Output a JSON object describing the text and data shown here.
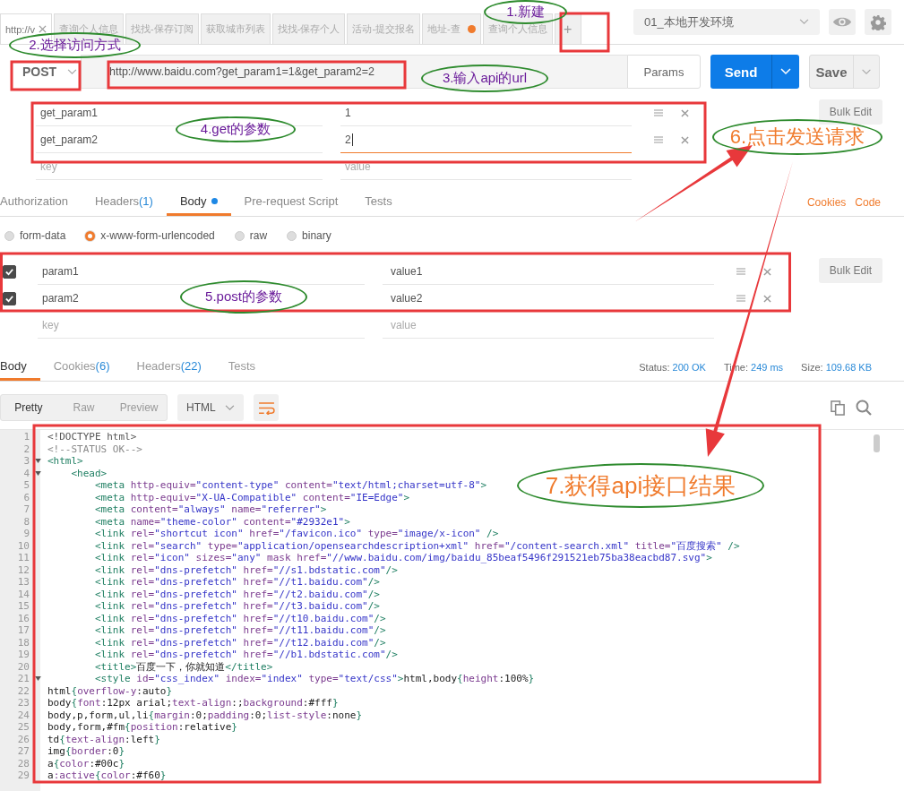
{
  "tabs": [
    {
      "label": "http://v",
      "selected": true,
      "unsaved": false
    },
    {
      "label": "查询个人信息",
      "selected": false,
      "unsaved": false
    },
    {
      "label": "找找-保存订阅",
      "selected": false,
      "unsaved": false
    },
    {
      "label": "获取城市列表",
      "selected": false,
      "unsaved": false
    },
    {
      "label": "找找-保存个人",
      "selected": false,
      "unsaved": false
    },
    {
      "label": "活动-提交报名",
      "selected": false,
      "unsaved": false
    },
    {
      "label": "地址-查",
      "selected": false,
      "unsaved": true
    },
    {
      "label": "查询个人信息",
      "selected": false,
      "unsaved": false
    }
  ],
  "new_tab": "+",
  "environment": {
    "value": "01_本地开发环境"
  },
  "request": {
    "method": "POST",
    "url": "http://www.baidu.com?get_param1=1&get_param2=2",
    "params_button": "Params",
    "send": "Send",
    "save": "Save"
  },
  "query_params": {
    "rows": [
      {
        "key": "get_param1",
        "value": "1",
        "focused": false
      },
      {
        "key": "get_param2",
        "value": "2",
        "focused": true
      }
    ],
    "key_placeholder": "key",
    "value_placeholder": "value",
    "bulk_edit": "Bulk Edit"
  },
  "request_tabs": [
    {
      "label": "Authorization",
      "selected": false,
      "modified": false
    },
    {
      "label": "Headers",
      "count": "(1)",
      "selected": false,
      "modified": false
    },
    {
      "label": "Body",
      "selected": true,
      "modified": true
    },
    {
      "label": "Pre-request Script",
      "selected": false,
      "modified": false
    },
    {
      "label": "Tests",
      "selected": false,
      "modified": false
    }
  ],
  "request_links": [
    "Cookies",
    "Code"
  ],
  "body_modes": [
    {
      "label": "form-data",
      "selected": false
    },
    {
      "label": "x-www-form-urlencoded",
      "selected": true
    },
    {
      "label": "raw",
      "selected": false
    },
    {
      "label": "binary",
      "selected": false
    }
  ],
  "body_params": {
    "rows": [
      {
        "key": "param1",
        "value": "value1",
        "checked": true
      },
      {
        "key": "param2",
        "value": "value2",
        "checked": true
      }
    ],
    "key_placeholder": "key",
    "value_placeholder": "value",
    "bulk_edit": "Bulk Edit"
  },
  "response_tabs": [
    {
      "label": "Body",
      "selected": true
    },
    {
      "label": "Cookies",
      "count": "(6)",
      "selected": false
    },
    {
      "label": "Headers",
      "count": "(22)",
      "selected": false
    },
    {
      "label": "Tests",
      "selected": false
    }
  ],
  "response_meta": [
    {
      "label": "Status:",
      "value": "200 OK"
    },
    {
      "label": "Time:",
      "value": "249 ms"
    },
    {
      "label": "Size:",
      "value": "109.68 KB"
    }
  ],
  "view_modes": [
    {
      "label": "Pretty",
      "selected": true
    },
    {
      "label": "Raw",
      "selected": false
    },
    {
      "label": "Preview",
      "selected": false
    }
  ],
  "format": "HTML",
  "code": [
    {
      "n": "1",
      "foldable": false,
      "tokens": [
        {
          "kind": "doc",
          "text": "<!DOCTYPE html>"
        }
      ]
    },
    {
      "n": "2",
      "foldable": false,
      "tokens": [
        {
          "kind": "comment",
          "text": "<!--STATUS OK-->"
        }
      ]
    },
    {
      "n": "3",
      "foldable": true,
      "tokens": [
        {
          "kind": "tag",
          "text": "<html>"
        }
      ]
    },
    {
      "n": "4",
      "foldable": true,
      "tokens": [
        {
          "kind": "tag",
          "text": "    <head>"
        }
      ]
    },
    {
      "n": "5",
      "foldable": false,
      "tokens": [
        {
          "kind": "tag",
          "text": "        <meta "
        },
        {
          "kind": "attr",
          "text": "http-equiv="
        },
        {
          "kind": "str",
          "text": "\"content-type\""
        },
        {
          "kind": "attr",
          "text": " content="
        },
        {
          "kind": "str",
          "text": "\"text/html;charset=utf-8\""
        },
        {
          "kind": "tag",
          "text": ">"
        }
      ]
    },
    {
      "n": "6",
      "foldable": false,
      "tokens": [
        {
          "kind": "tag",
          "text": "        <meta "
        },
        {
          "kind": "attr",
          "text": "http-equiv="
        },
        {
          "kind": "str",
          "text": "\"X-UA-Compatible\""
        },
        {
          "kind": "attr",
          "text": " content="
        },
        {
          "kind": "str",
          "text": "\"IE=Edge\""
        },
        {
          "kind": "tag",
          "text": ">"
        }
      ]
    },
    {
      "n": "7",
      "foldable": false,
      "tokens": [
        {
          "kind": "tag",
          "text": "        <meta "
        },
        {
          "kind": "attr",
          "text": "content="
        },
        {
          "kind": "str",
          "text": "\"always\""
        },
        {
          "kind": "attr",
          "text": " name="
        },
        {
          "kind": "str",
          "text": "\"referrer\""
        },
        {
          "kind": "tag",
          "text": ">"
        }
      ]
    },
    {
      "n": "8",
      "foldable": false,
      "tokens": [
        {
          "kind": "tag",
          "text": "        <meta "
        },
        {
          "kind": "attr",
          "text": "name="
        },
        {
          "kind": "str",
          "text": "\"theme-color\""
        },
        {
          "kind": "attr",
          "text": " content="
        },
        {
          "kind": "str",
          "text": "\"#2932e1\""
        },
        {
          "kind": "tag",
          "text": ">"
        }
      ]
    },
    {
      "n": "9",
      "foldable": false,
      "tokens": [
        {
          "kind": "tag",
          "text": "        <link "
        },
        {
          "kind": "attr",
          "text": "rel="
        },
        {
          "kind": "str",
          "text": "\"shortcut icon\""
        },
        {
          "kind": "attr",
          "text": " href="
        },
        {
          "kind": "str",
          "text": "\"/favicon.ico\""
        },
        {
          "kind": "attr",
          "text": " type="
        },
        {
          "kind": "str",
          "text": "\"image/x-icon\""
        },
        {
          "kind": "tag",
          "text": " />"
        }
      ]
    },
    {
      "n": "10",
      "foldable": false,
      "tokens": [
        {
          "kind": "tag",
          "text": "        <link "
        },
        {
          "kind": "attr",
          "text": "rel="
        },
        {
          "kind": "str",
          "text": "\"search\""
        },
        {
          "kind": "attr",
          "text": " type="
        },
        {
          "kind": "str",
          "text": "\"application/opensearchdescription+xml\""
        },
        {
          "kind": "attr",
          "text": " href="
        },
        {
          "kind": "str",
          "text": "\"/content-search.xml\""
        },
        {
          "kind": "attr",
          "text": " title="
        },
        {
          "kind": "str",
          "text": "\"百度搜索\""
        },
        {
          "kind": "tag",
          "text": " />"
        }
      ]
    },
    {
      "n": "11",
      "foldable": false,
      "tokens": [
        {
          "kind": "tag",
          "text": "        <link "
        },
        {
          "kind": "attr",
          "text": "rel="
        },
        {
          "kind": "str",
          "text": "\"icon\""
        },
        {
          "kind": "attr",
          "text": " sizes="
        },
        {
          "kind": "str",
          "text": "\"any\""
        },
        {
          "kind": "attr",
          "text": " mask href="
        },
        {
          "kind": "str",
          "text": "\"//www.baidu.com/img/baidu_85beaf5496f291521eb75ba38eacbd87.svg\""
        },
        {
          "kind": "tag",
          "text": ">"
        }
      ]
    },
    {
      "n": "12",
      "foldable": false,
      "tokens": [
        {
          "kind": "tag",
          "text": "        <link "
        },
        {
          "kind": "attr",
          "text": "rel="
        },
        {
          "kind": "str",
          "text": "\"dns-prefetch\""
        },
        {
          "kind": "attr",
          "text": " href="
        },
        {
          "kind": "str",
          "text": "\"//s1.bdstatic.com\""
        },
        {
          "kind": "tag",
          "text": "/>"
        }
      ]
    },
    {
      "n": "13",
      "foldable": false,
      "tokens": [
        {
          "kind": "tag",
          "text": "        <link "
        },
        {
          "kind": "attr",
          "text": "rel="
        },
        {
          "kind": "str",
          "text": "\"dns-prefetch\""
        },
        {
          "kind": "attr",
          "text": " href="
        },
        {
          "kind": "str",
          "text": "\"//t1.baidu.com\""
        },
        {
          "kind": "tag",
          "text": "/>"
        }
      ]
    },
    {
      "n": "14",
      "foldable": false,
      "tokens": [
        {
          "kind": "tag",
          "text": "        <link "
        },
        {
          "kind": "attr",
          "text": "rel="
        },
        {
          "kind": "str",
          "text": "\"dns-prefetch\""
        },
        {
          "kind": "attr",
          "text": " href="
        },
        {
          "kind": "str",
          "text": "\"//t2.baidu.com\""
        },
        {
          "kind": "tag",
          "text": "/>"
        }
      ]
    },
    {
      "n": "15",
      "foldable": false,
      "tokens": [
        {
          "kind": "tag",
          "text": "        <link "
        },
        {
          "kind": "attr",
          "text": "rel="
        },
        {
          "kind": "str",
          "text": "\"dns-prefetch\""
        },
        {
          "kind": "attr",
          "text": " href="
        },
        {
          "kind": "str",
          "text": "\"//t3.baidu.com\""
        },
        {
          "kind": "tag",
          "text": "/>"
        }
      ]
    },
    {
      "n": "16",
      "foldable": false,
      "tokens": [
        {
          "kind": "tag",
          "text": "        <link "
        },
        {
          "kind": "attr",
          "text": "rel="
        },
        {
          "kind": "str",
          "text": "\"dns-prefetch\""
        },
        {
          "kind": "attr",
          "text": " href="
        },
        {
          "kind": "str",
          "text": "\"//t10.baidu.com\""
        },
        {
          "kind": "tag",
          "text": "/>"
        }
      ]
    },
    {
      "n": "17",
      "foldable": false,
      "tokens": [
        {
          "kind": "tag",
          "text": "        <link "
        },
        {
          "kind": "attr",
          "text": "rel="
        },
        {
          "kind": "str",
          "text": "\"dns-prefetch\""
        },
        {
          "kind": "attr",
          "text": " href="
        },
        {
          "kind": "str",
          "text": "\"//t11.baidu.com\""
        },
        {
          "kind": "tag",
          "text": "/>"
        }
      ]
    },
    {
      "n": "18",
      "foldable": false,
      "tokens": [
        {
          "kind": "tag",
          "text": "        <link "
        },
        {
          "kind": "attr",
          "text": "rel="
        },
        {
          "kind": "str",
          "text": "\"dns-prefetch\""
        },
        {
          "kind": "attr",
          "text": " href="
        },
        {
          "kind": "str",
          "text": "\"//t12.baidu.com\""
        },
        {
          "kind": "tag",
          "text": "/>"
        }
      ]
    },
    {
      "n": "19",
      "foldable": false,
      "tokens": [
        {
          "kind": "tag",
          "text": "        <link "
        },
        {
          "kind": "attr",
          "text": "rel="
        },
        {
          "kind": "str",
          "text": "\"dns-prefetch\""
        },
        {
          "kind": "attr",
          "text": " href="
        },
        {
          "kind": "str",
          "text": "\"//b1.bdstatic.com\""
        },
        {
          "kind": "tag",
          "text": "/>"
        }
      ]
    },
    {
      "n": "20",
      "foldable": false,
      "tokens": [
        {
          "kind": "tag",
          "text": "        <title>"
        },
        {
          "kind": "plain",
          "text": "百度一下，你就知道"
        },
        {
          "kind": "tag",
          "text": "</title>"
        }
      ]
    },
    {
      "n": "21",
      "foldable": true,
      "tokens": [
        {
          "kind": "tag",
          "text": "        <style "
        },
        {
          "kind": "attr",
          "text": "id="
        },
        {
          "kind": "str",
          "text": "\"css_index\""
        },
        {
          "kind": "attr",
          "text": " index="
        },
        {
          "kind": "str",
          "text": "\"index\""
        },
        {
          "kind": "attr",
          "text": " type="
        },
        {
          "kind": "str",
          "text": "\"text/css\""
        },
        {
          "kind": "tag",
          "text": ">"
        },
        {
          "kind": "plain",
          "text": "html,body"
        },
        {
          "kind": "tag",
          "text": "{"
        },
        {
          "kind": "prop",
          "text": "height"
        },
        {
          "kind": "plain",
          "text": ":100%"
        },
        {
          "kind": "tag",
          "text": "}"
        }
      ]
    },
    {
      "n": "22",
      "foldable": false,
      "tokens": [
        {
          "kind": "plain",
          "text": "html"
        },
        {
          "kind": "tag",
          "text": "{"
        },
        {
          "kind": "prop",
          "text": "overflow-y"
        },
        {
          "kind": "plain",
          "text": ":auto"
        },
        {
          "kind": "tag",
          "text": "}"
        }
      ]
    },
    {
      "n": "23",
      "foldable": false,
      "tokens": [
        {
          "kind": "plain",
          "text": "body"
        },
        {
          "kind": "tag",
          "text": "{"
        },
        {
          "kind": "prop",
          "text": "font"
        },
        {
          "kind": "plain",
          "text": ":12px arial;"
        },
        {
          "kind": "prop",
          "text": "text-align"
        },
        {
          "kind": "plain",
          "text": ":;"
        },
        {
          "kind": "prop",
          "text": "background"
        },
        {
          "kind": "plain",
          "text": ":#fff"
        },
        {
          "kind": "tag",
          "text": "}"
        }
      ]
    },
    {
      "n": "24",
      "foldable": false,
      "tokens": [
        {
          "kind": "plain",
          "text": "body,p,form,ul,li"
        },
        {
          "kind": "tag",
          "text": "{"
        },
        {
          "kind": "prop",
          "text": "margin"
        },
        {
          "kind": "plain",
          "text": ":0;"
        },
        {
          "kind": "prop",
          "text": "padding"
        },
        {
          "kind": "plain",
          "text": ":0;"
        },
        {
          "kind": "prop",
          "text": "list-style"
        },
        {
          "kind": "plain",
          "text": ":none"
        },
        {
          "kind": "tag",
          "text": "}"
        }
      ]
    },
    {
      "n": "25",
      "foldable": false,
      "tokens": [
        {
          "kind": "plain",
          "text": "body,form,#fm"
        },
        {
          "kind": "tag",
          "text": "{"
        },
        {
          "kind": "prop",
          "text": "position"
        },
        {
          "kind": "plain",
          "text": ":relative"
        },
        {
          "kind": "tag",
          "text": "}"
        }
      ]
    },
    {
      "n": "26",
      "foldable": false,
      "tokens": [
        {
          "kind": "plain",
          "text": "td"
        },
        {
          "kind": "tag",
          "text": "{"
        },
        {
          "kind": "prop",
          "text": "text-align"
        },
        {
          "kind": "plain",
          "text": ":left"
        },
        {
          "kind": "tag",
          "text": "}"
        }
      ]
    },
    {
      "n": "27",
      "foldable": false,
      "tokens": [
        {
          "kind": "plain",
          "text": "img"
        },
        {
          "kind": "tag",
          "text": "{"
        },
        {
          "kind": "prop",
          "text": "border"
        },
        {
          "kind": "plain",
          "text": ":0"
        },
        {
          "kind": "tag",
          "text": "}"
        }
      ]
    },
    {
      "n": "28",
      "foldable": false,
      "tokens": [
        {
          "kind": "plain",
          "text": "a"
        },
        {
          "kind": "tag",
          "text": "{"
        },
        {
          "kind": "prop",
          "text": "color"
        },
        {
          "kind": "plain",
          "text": ":#00c"
        },
        {
          "kind": "tag",
          "text": "}"
        }
      ]
    },
    {
      "n": "29",
      "foldable": false,
      "tokens": [
        {
          "kind": "plain",
          "text": "a"
        },
        {
          "kind": "prop",
          "text": ":active"
        },
        {
          "kind": "tag",
          "text": "{"
        },
        {
          "kind": "prop",
          "text": "color"
        },
        {
          "kind": "plain",
          "text": ":#f60"
        },
        {
          "kind": "tag",
          "text": "}"
        }
      ]
    }
  ],
  "annotations": [
    {
      "label": "1.新建",
      "kind": "note"
    },
    {
      "label": "2.选择访问方式",
      "kind": "note"
    },
    {
      "label": "3.输入api的url",
      "kind": "note"
    },
    {
      "label": "4.get的参数",
      "kind": "note"
    },
    {
      "label": "5.post的参数",
      "kind": "note"
    },
    {
      "label": "6.点击发送请求",
      "kind": "callout"
    },
    {
      "label": "7.获得api接口结果",
      "kind": "callout"
    }
  ]
}
